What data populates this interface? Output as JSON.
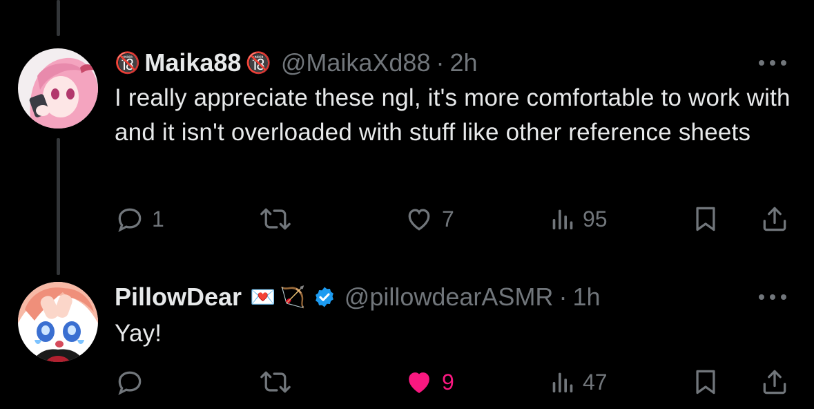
{
  "posts": [
    {
      "display_name": "Maika88",
      "name_prefix_emoji": "🔞",
      "name_suffix_emoji": "🔞",
      "handle": "@MaikaXd88",
      "time": "2h",
      "text": "I really appreciate these ngl, it's more comfortable to work with and it isn't overloaded with stuff like other reference sheets",
      "reply_count": "1",
      "repost_count": "",
      "like_count": "7",
      "view_count": "95",
      "liked": false
    },
    {
      "display_name": "PillowDear",
      "name_badges": [
        "💌",
        "🏹"
      ],
      "verified": true,
      "handle": "@pillowdearASMR",
      "time": "1h",
      "text": "Yay!",
      "reply_count": "",
      "repost_count": "",
      "like_count": "9",
      "view_count": "47",
      "liked": true
    }
  ],
  "colors": {
    "background": "#000000",
    "text": "#e7e9ea",
    "muted": "#71767b",
    "like_active": "#f91880",
    "verified": "#1d9bf0"
  },
  "icons": [
    "reply-icon",
    "repost-icon",
    "like-icon",
    "views-icon",
    "bookmark-icon",
    "share-icon",
    "more-icon",
    "verified-badge-icon"
  ],
  "separator": "·"
}
